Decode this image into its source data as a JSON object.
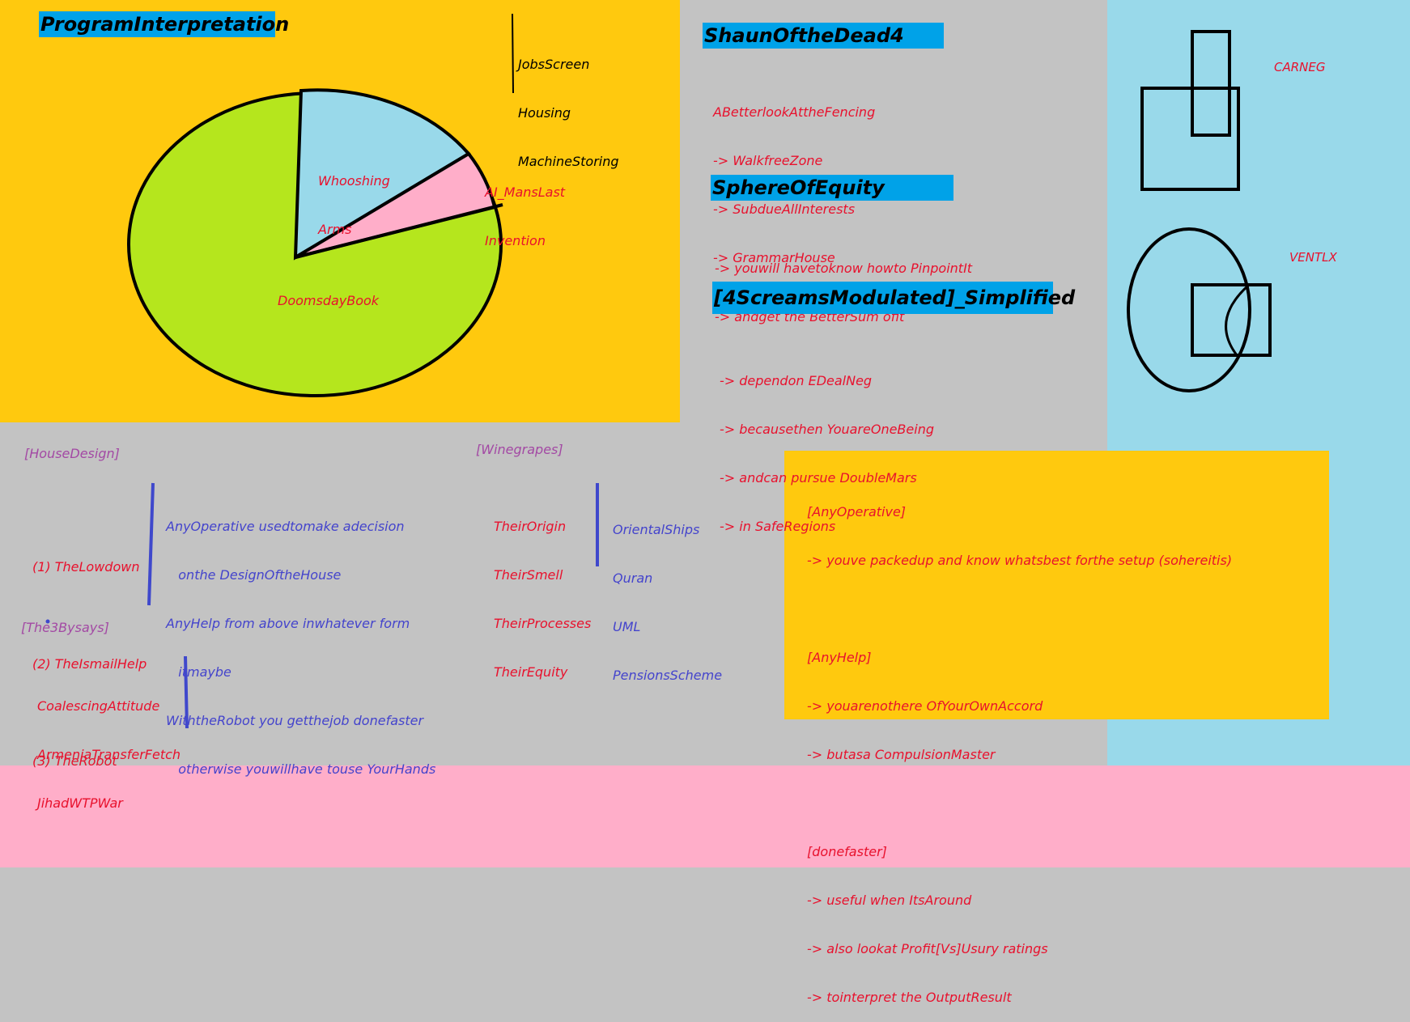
{
  "colors": {
    "canvas": "#c3c3c3",
    "orange": "#ffc90e",
    "light_blue": "#99d9ea",
    "pink": "#ffaec9",
    "lime": "#b5e61d",
    "heading_blue": "#00a2e8",
    "red_text": "#e8112d",
    "blue_text": "#4444cc",
    "purple_text": "#a349a4"
  },
  "program_interpretation": {
    "title": "ProgramInterpretation",
    "top_list": [
      "JobsScreen",
      "Housing",
      "MachineStoring"
    ],
    "pie_labels": {
      "whooshing": [
        "Whooshing",
        "Arms"
      ],
      "ai": [
        "AI_MansLast",
        "Invention"
      ],
      "doomsday": "DoomsdayBook"
    }
  },
  "shaun": {
    "title": "ShaunOftheDead4",
    "lines": [
      "ABetterlookAttheFencing",
      "-> WalkfreeZone",
      "-> SubdueAllInterests",
      "-> GrammarHouse"
    ]
  },
  "sphere": {
    "title": "SphereOfEquity",
    "lines": [
      "-> youwill havetoknow howto PinpointIt",
      "-> andget the BetterSum ofit"
    ]
  },
  "screams": {
    "title": "[4ScreamsModulated]_Simplified",
    "lines": [
      "-> dependon EDealNeg",
      "-> becausethen YouareOneBeing",
      "-> andcan pursue DoubleMars",
      "-> in SafeRegions"
    ]
  },
  "right_panel": {
    "carneg": "CARNEG",
    "ventlx": "VENTLX"
  },
  "house_design": {
    "tag": "[HouseDesign]",
    "items": [
      "(1) TheLowdown",
      "(2) TheIsmailHelp",
      "(3) TheRobot"
    ],
    "notes": [
      "AnyOperative usedtomake adecision",
      "   onthe DesignOftheHouse",
      "AnyHelp from above inwhatever form",
      "   itmaybe",
      "WiththeRobot you getthejob donefaster",
      "   otherwise youwillhave touse YourHands"
    ]
  },
  "three_bys": {
    "tag": "[The3Bysays]",
    "items": [
      "CoalescingAttitude",
      "ArmeniaTransferFetch",
      "JihadWTPWar"
    ]
  },
  "winegrapes": {
    "tag": "[Winegrapes]",
    "left": [
      "TheirOrigin",
      "TheirSmell",
      "TheirProcesses",
      "TheirEquity"
    ],
    "right": [
      "OrientalShips",
      "Quran",
      "UML",
      "PensionsScheme"
    ]
  },
  "any_operative_box": {
    "sections": [
      {
        "tag": "[AnyOperative]",
        "lines": [
          "-> youve packedup and know whatsbest forthe setup (sohereitis)"
        ]
      },
      {
        "tag": "[AnyHelp]",
        "lines": [
          "-> youarenothere OfYourOwnAccord",
          "-> butasa CompulsionMaster"
        ]
      },
      {
        "tag": "[donefaster]",
        "lines": [
          "-> useful when ItsAround",
          "-> also lookat Profit[Vs]Usury ratings",
          "-> tointerpret the OutputResult"
        ]
      }
    ]
  }
}
